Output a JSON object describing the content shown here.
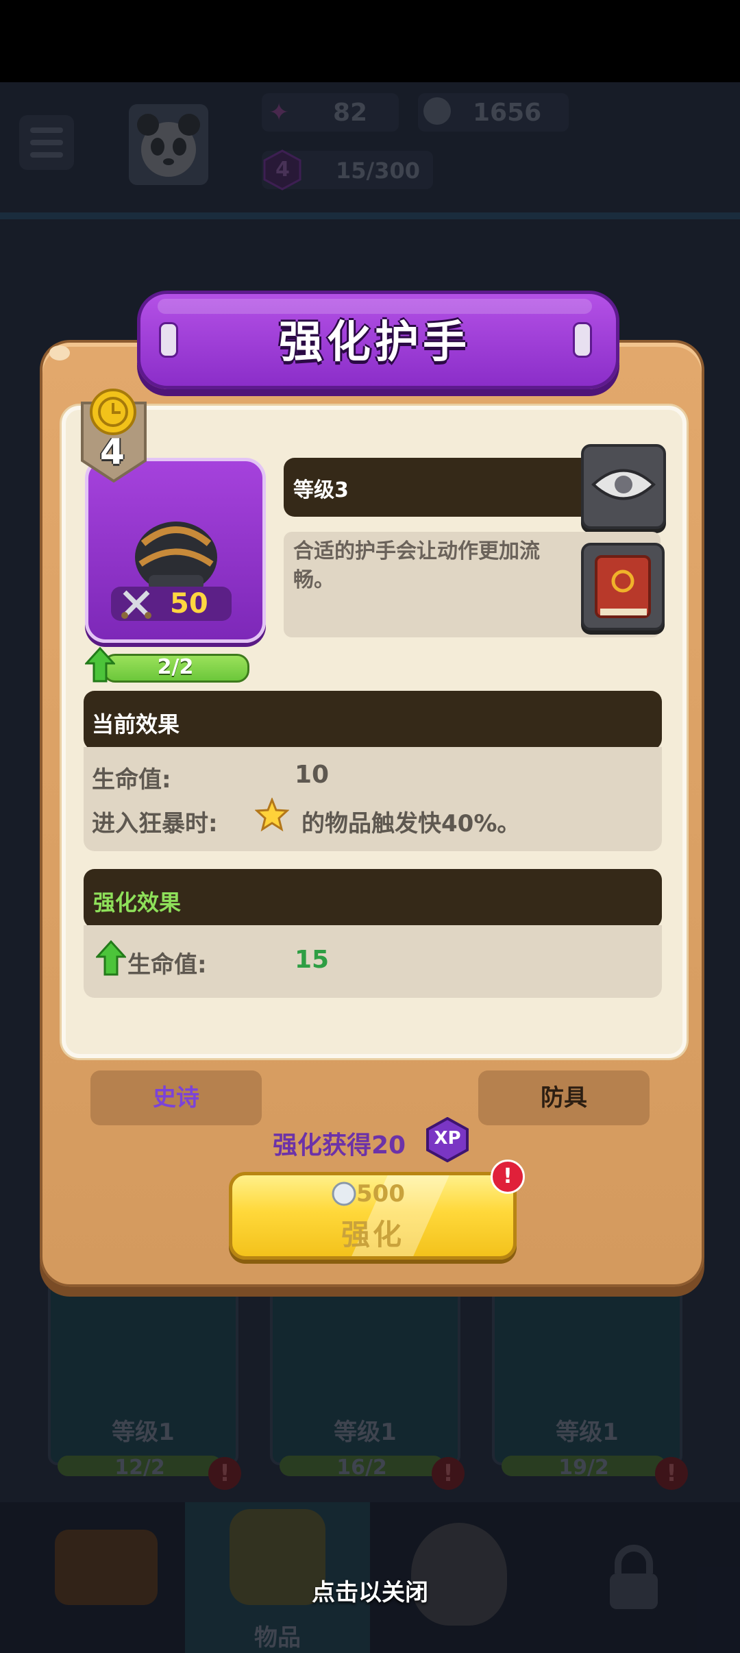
{
  "header": {
    "gems": "82",
    "coins": "1656",
    "player_level": "4",
    "xp_progress": "15/300"
  },
  "background": {
    "cards": [
      {
        "level": "等级1",
        "progress": "12/2"
      },
      {
        "level": "等级1",
        "progress": "16/2"
      },
      {
        "level": "等级1",
        "progress": "19/2"
      }
    ],
    "nav_label": "物品"
  },
  "modal": {
    "title": "强化护手",
    "item": {
      "tier_badge": "4",
      "power": "50",
      "upgrade_progress": "2/2"
    },
    "level_label": "等级3",
    "description": "合适的护手会让动作更加流畅。",
    "current_effects": {
      "heading": "当前效果",
      "rows": [
        {
          "label": "生命值:",
          "value": "10"
        },
        {
          "label": "进入狂暴时:",
          "value": "的物品触发快40%。",
          "icon": "star-icon"
        }
      ]
    },
    "upgrade_effects": {
      "heading": "强化效果",
      "rows": [
        {
          "label": "生命值:",
          "value": "15"
        }
      ]
    },
    "tags": {
      "rarity": "史诗",
      "category": "防具"
    },
    "xp_reward": "强化获得20",
    "xp_badge": "XP",
    "upgrade_button": {
      "cost": "500",
      "label": "强化",
      "alert": "!"
    },
    "close_hint": "点击以关闭"
  },
  "colors": {
    "title_purple": "#9a3bd6",
    "panel_orange": "#d9a065",
    "dark_header": "#352918",
    "green_value": "#2e9e44",
    "epic_text": "#7b43d8",
    "button_yellow": "#ffd83a"
  }
}
